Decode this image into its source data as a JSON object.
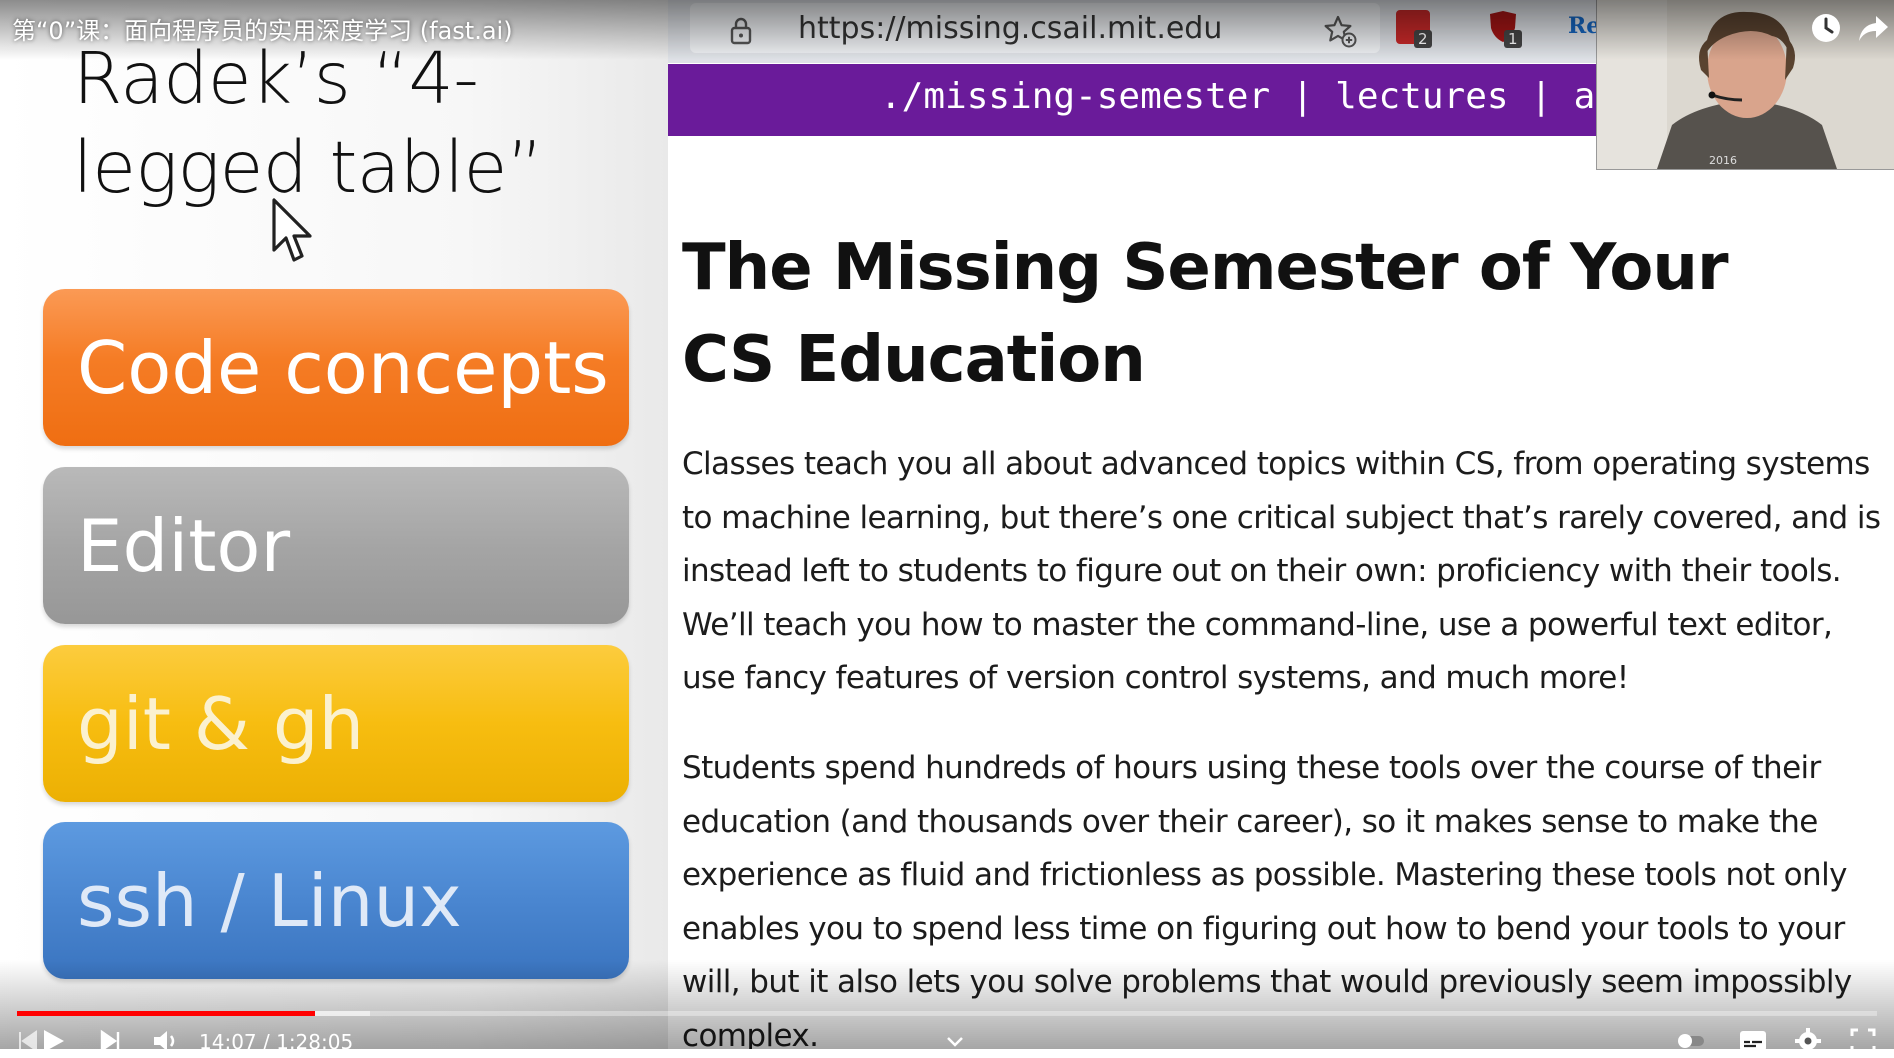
{
  "video": {
    "title": "第“0”课：面向程序员的实用深度学习 (fast.ai)",
    "time_current": "14:07",
    "time_separator": " / ",
    "time_total": "1:28:05",
    "progress_fraction": 0.16,
    "buffer_fraction": 0.19,
    "accent_color": "#ff0000"
  },
  "slide": {
    "title": "Radek’s “4-legged table”",
    "pillars": [
      {
        "label": "Code concepts",
        "color": "#f57c25"
      },
      {
        "label": "Editor",
        "color": "#a5a5a5"
      },
      {
        "label": "git & gh",
        "color": "#f7bd10"
      },
      {
        "label": "ssh / Linux",
        "color": "#4a86d0"
      }
    ]
  },
  "browser": {
    "url": "https://missing.csail.mit.edu",
    "extension_badges": [
      "2",
      "1"
    ],
    "extension_label": "Re",
    "nav_text": "./missing-semester | lectures | a",
    "nav_color": "#6a1b9a",
    "heading": "The Missing Semester of Your CS Education",
    "paragraphs": [
      "Classes teach you all about advanced topics within CS, from operating systems to machine learning, but there’s one critical subject that’s rarely covered, and is instead left to students to figure out on their own: proficiency with their tools. We’ll teach you how to master the command-line, use a powerful text editor, use fancy features of version control systems, and much more!",
      "Students spend hundreds of hours using these tools over the course of their education (and thousands over their career), so it makes sense to make the experience as fluid and frictionless as possible. Mastering these tools not only enables you to spend less time on figuring out how to bend your tools to your will, but it also lets you solve problems that would previously seem impossibly complex."
    ]
  },
  "webcam": {
    "shirt_text": "2016"
  }
}
